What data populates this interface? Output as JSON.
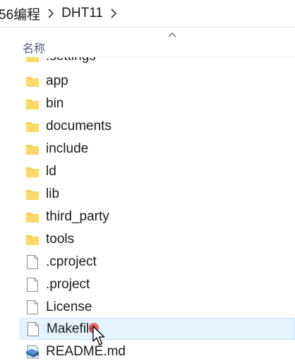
{
  "breadcrumb": {
    "items": [
      "56编程",
      "DHT11"
    ]
  },
  "column_header": {
    "name_label": "名称"
  },
  "files": [
    {
      "name": ".settings",
      "type": "folder",
      "partial": true
    },
    {
      "name": "app",
      "type": "folder"
    },
    {
      "name": "bin",
      "type": "folder"
    },
    {
      "name": "documents",
      "type": "folder"
    },
    {
      "name": "include",
      "type": "folder"
    },
    {
      "name": "ld",
      "type": "folder"
    },
    {
      "name": "lib",
      "type": "folder"
    },
    {
      "name": "third_party",
      "type": "folder"
    },
    {
      "name": "tools",
      "type": "folder"
    },
    {
      "name": ".cproject",
      "type": "file"
    },
    {
      "name": ".project",
      "type": "file"
    },
    {
      "name": "License",
      "type": "file"
    },
    {
      "name": "Makefile",
      "type": "file",
      "hovered": true
    },
    {
      "name": "README.md",
      "type": "markdown"
    }
  ],
  "icons": {
    "folder": "folder-icon",
    "file": "file-icon",
    "markdown": "markdown-file-icon",
    "breadcrumb_separator": "chevron-right-icon",
    "collapse": "chevron-up-icon",
    "cursor": "mouse-pointer-icon"
  },
  "colors": {
    "folder": "#f8cf4f",
    "hover_bg": "#e5f3ff",
    "header_text": "#4d6082"
  }
}
